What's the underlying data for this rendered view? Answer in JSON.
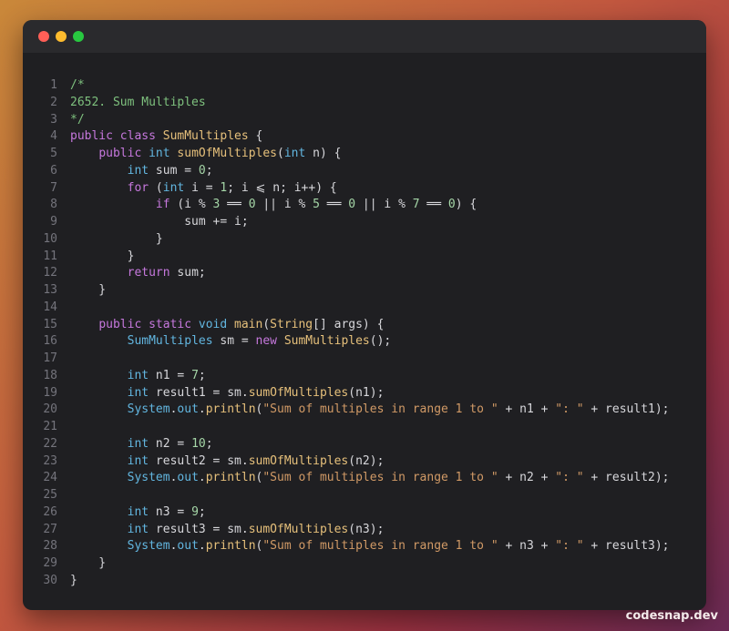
{
  "editor": {
    "lines": [
      {
        "num": "1",
        "tokens": [
          {
            "cls": "c",
            "text": "/*"
          }
        ]
      },
      {
        "num": "2",
        "tokens": [
          {
            "cls": "c",
            "text": "2652. Sum Multiples"
          }
        ]
      },
      {
        "num": "3",
        "tokens": [
          {
            "cls": "c",
            "text": "*/"
          }
        ]
      },
      {
        "num": "4",
        "tokens": [
          {
            "cls": "k",
            "text": "public class "
          },
          {
            "cls": "f",
            "text": "SumMultiples"
          },
          {
            "cls": "o",
            "text": " {"
          }
        ]
      },
      {
        "num": "5",
        "tokens": [
          {
            "cls": "o",
            "text": "    "
          },
          {
            "cls": "k",
            "text": "public "
          },
          {
            "cls": "t",
            "text": "int "
          },
          {
            "cls": "f",
            "text": "sumOfMultiples"
          },
          {
            "cls": "o",
            "text": "("
          },
          {
            "cls": "t",
            "text": "int"
          },
          {
            "cls": "o",
            "text": " n) {"
          }
        ]
      },
      {
        "num": "6",
        "tokens": [
          {
            "cls": "o",
            "text": "        "
          },
          {
            "cls": "t",
            "text": "int"
          },
          {
            "cls": "o",
            "text": " sum = "
          },
          {
            "cls": "n",
            "text": "0"
          },
          {
            "cls": "o",
            "text": ";"
          }
        ]
      },
      {
        "num": "7",
        "tokens": [
          {
            "cls": "o",
            "text": "        "
          },
          {
            "cls": "k",
            "text": "for"
          },
          {
            "cls": "o",
            "text": " ("
          },
          {
            "cls": "t",
            "text": "int"
          },
          {
            "cls": "o",
            "text": " i = "
          },
          {
            "cls": "n",
            "text": "1"
          },
          {
            "cls": "o",
            "text": "; i ⩽ n; i++) {"
          }
        ]
      },
      {
        "num": "8",
        "tokens": [
          {
            "cls": "o",
            "text": "            "
          },
          {
            "cls": "k",
            "text": "if"
          },
          {
            "cls": "o",
            "text": " (i % "
          },
          {
            "cls": "n",
            "text": "3"
          },
          {
            "cls": "o",
            "text": " ══ "
          },
          {
            "cls": "n",
            "text": "0"
          },
          {
            "cls": "o",
            "text": " || i % "
          },
          {
            "cls": "n",
            "text": "5"
          },
          {
            "cls": "o",
            "text": " ══ "
          },
          {
            "cls": "n",
            "text": "0"
          },
          {
            "cls": "o",
            "text": " || i % "
          },
          {
            "cls": "n",
            "text": "7"
          },
          {
            "cls": "o",
            "text": " ══ "
          },
          {
            "cls": "n",
            "text": "0"
          },
          {
            "cls": "o",
            "text": ") {"
          }
        ]
      },
      {
        "num": "9",
        "tokens": [
          {
            "cls": "o",
            "text": "                sum += i;"
          }
        ]
      },
      {
        "num": "10",
        "tokens": [
          {
            "cls": "o",
            "text": "            }"
          }
        ]
      },
      {
        "num": "11",
        "tokens": [
          {
            "cls": "o",
            "text": "        }"
          }
        ]
      },
      {
        "num": "12",
        "tokens": [
          {
            "cls": "o",
            "text": "        "
          },
          {
            "cls": "k",
            "text": "return"
          },
          {
            "cls": "o",
            "text": " sum;"
          }
        ]
      },
      {
        "num": "13",
        "tokens": [
          {
            "cls": "o",
            "text": "    }"
          }
        ]
      },
      {
        "num": "14",
        "tokens": []
      },
      {
        "num": "15",
        "tokens": [
          {
            "cls": "o",
            "text": "    "
          },
          {
            "cls": "k",
            "text": "public static "
          },
          {
            "cls": "t",
            "text": "void "
          },
          {
            "cls": "f",
            "text": "main"
          },
          {
            "cls": "o",
            "text": "("
          },
          {
            "cls": "f",
            "text": "String"
          },
          {
            "cls": "o",
            "text": "[] args) {"
          }
        ]
      },
      {
        "num": "16",
        "tokens": [
          {
            "cls": "o",
            "text": "        "
          },
          {
            "cls": "t",
            "text": "SumMultiples"
          },
          {
            "cls": "o",
            "text": " sm = "
          },
          {
            "cls": "k",
            "text": "new "
          },
          {
            "cls": "f",
            "text": "SumMultiples"
          },
          {
            "cls": "o",
            "text": "();"
          }
        ]
      },
      {
        "num": "17",
        "tokens": []
      },
      {
        "num": "18",
        "tokens": [
          {
            "cls": "o",
            "text": "        "
          },
          {
            "cls": "t",
            "text": "int"
          },
          {
            "cls": "o",
            "text": " n1 = "
          },
          {
            "cls": "n",
            "text": "7"
          },
          {
            "cls": "o",
            "text": ";"
          }
        ]
      },
      {
        "num": "19",
        "tokens": [
          {
            "cls": "o",
            "text": "        "
          },
          {
            "cls": "t",
            "text": "int"
          },
          {
            "cls": "o",
            "text": " result1 = sm."
          },
          {
            "cls": "f",
            "text": "sumOfMultiples"
          },
          {
            "cls": "o",
            "text": "(n1);"
          }
        ]
      },
      {
        "num": "20",
        "tokens": [
          {
            "cls": "o",
            "text": "        "
          },
          {
            "cls": "t",
            "text": "System"
          },
          {
            "cls": "o",
            "text": "."
          },
          {
            "cls": "t",
            "text": "out"
          },
          {
            "cls": "o",
            "text": "."
          },
          {
            "cls": "f",
            "text": "println"
          },
          {
            "cls": "o",
            "text": "("
          },
          {
            "cls": "s",
            "text": "\"Sum of multiples in range 1 to \""
          },
          {
            "cls": "o",
            "text": " + n1 + "
          },
          {
            "cls": "s",
            "text": "\": \""
          },
          {
            "cls": "o",
            "text": " + result1);"
          }
        ]
      },
      {
        "num": "21",
        "tokens": []
      },
      {
        "num": "22",
        "tokens": [
          {
            "cls": "o",
            "text": "        "
          },
          {
            "cls": "t",
            "text": "int"
          },
          {
            "cls": "o",
            "text": " n2 = "
          },
          {
            "cls": "n",
            "text": "10"
          },
          {
            "cls": "o",
            "text": ";"
          }
        ]
      },
      {
        "num": "23",
        "tokens": [
          {
            "cls": "o",
            "text": "        "
          },
          {
            "cls": "t",
            "text": "int"
          },
          {
            "cls": "o",
            "text": " result2 = sm."
          },
          {
            "cls": "f",
            "text": "sumOfMultiples"
          },
          {
            "cls": "o",
            "text": "(n2);"
          }
        ]
      },
      {
        "num": "24",
        "tokens": [
          {
            "cls": "o",
            "text": "        "
          },
          {
            "cls": "t",
            "text": "System"
          },
          {
            "cls": "o",
            "text": "."
          },
          {
            "cls": "t",
            "text": "out"
          },
          {
            "cls": "o",
            "text": "."
          },
          {
            "cls": "f",
            "text": "println"
          },
          {
            "cls": "o",
            "text": "("
          },
          {
            "cls": "s",
            "text": "\"Sum of multiples in range 1 to \""
          },
          {
            "cls": "o",
            "text": " + n2 + "
          },
          {
            "cls": "s",
            "text": "\": \""
          },
          {
            "cls": "o",
            "text": " + result2);"
          }
        ]
      },
      {
        "num": "25",
        "tokens": []
      },
      {
        "num": "26",
        "tokens": [
          {
            "cls": "o",
            "text": "        "
          },
          {
            "cls": "t",
            "text": "int"
          },
          {
            "cls": "o",
            "text": " n3 = "
          },
          {
            "cls": "n",
            "text": "9"
          },
          {
            "cls": "o",
            "text": ";"
          }
        ]
      },
      {
        "num": "27",
        "tokens": [
          {
            "cls": "o",
            "text": "        "
          },
          {
            "cls": "t",
            "text": "int"
          },
          {
            "cls": "o",
            "text": " result3 = sm."
          },
          {
            "cls": "f",
            "text": "sumOfMultiples"
          },
          {
            "cls": "o",
            "text": "(n3);"
          }
        ]
      },
      {
        "num": "28",
        "tokens": [
          {
            "cls": "o",
            "text": "        "
          },
          {
            "cls": "t",
            "text": "System"
          },
          {
            "cls": "o",
            "text": "."
          },
          {
            "cls": "t",
            "text": "out"
          },
          {
            "cls": "o",
            "text": "."
          },
          {
            "cls": "f",
            "text": "println"
          },
          {
            "cls": "o",
            "text": "("
          },
          {
            "cls": "s",
            "text": "\"Sum of multiples in range 1 to \""
          },
          {
            "cls": "o",
            "text": " + n3 + "
          },
          {
            "cls": "s",
            "text": "\": \""
          },
          {
            "cls": "o",
            "text": " + result3);"
          }
        ]
      },
      {
        "num": "29",
        "tokens": [
          {
            "cls": "o",
            "text": "    }"
          }
        ]
      },
      {
        "num": "30",
        "tokens": [
          {
            "cls": "o",
            "text": "}"
          }
        ]
      }
    ]
  },
  "watermark": "codesnap.dev",
  "colors": {
    "close": "#ff5f57",
    "minimize": "#febc2e",
    "maximize": "#28c840",
    "window_bg": "#1f1f22"
  }
}
